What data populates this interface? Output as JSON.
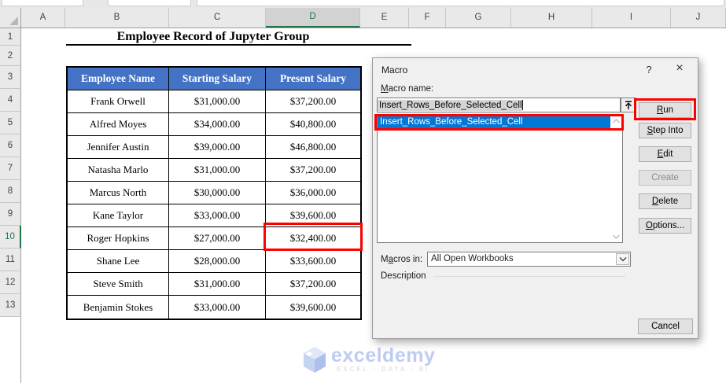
{
  "sheet": {
    "column_labels": [
      "A",
      "B",
      "C",
      "D",
      "E",
      "F",
      "G",
      "H",
      "I",
      "J"
    ],
    "row_labels": [
      "1",
      "2",
      "3",
      "4",
      "5",
      "6",
      "7",
      "8",
      "9",
      "10",
      "11",
      "12",
      "13"
    ],
    "selected_column": "D",
    "selected_row": "10",
    "title": "Employee Record of Jupyter Group",
    "table": {
      "headers": [
        "Employee Name",
        "Starting Salary",
        "Present Salary"
      ],
      "rows": [
        [
          "Frank Orwell",
          "$31,000.00",
          "$37,200.00"
        ],
        [
          "Alfred Moyes",
          "$34,000.00",
          "$40,800.00"
        ],
        [
          "Jennifer Austin",
          "$39,000.00",
          "$46,800.00"
        ],
        [
          "Natasha Marlo",
          "$31,000.00",
          "$37,200.00"
        ],
        [
          "Marcus North",
          "$30,000.00",
          "$36,000.00"
        ],
        [
          "Kane Taylor",
          "$33,000.00",
          "$39,600.00"
        ],
        [
          "Roger Hopkins",
          "$27,000.00",
          "$32,400.00"
        ],
        [
          "Shane Lee",
          "$28,000.00",
          "$33,600.00"
        ],
        [
          "Steve Smith",
          "$31,000.00",
          "$37,200.00"
        ],
        [
          "Benjamin Stokes",
          "$33,000.00",
          "$39,600.00"
        ]
      ],
      "highlighted_cell_value": "$32,400.00"
    }
  },
  "dialog": {
    "title": "Macro",
    "help_label": "?",
    "close_label": "×",
    "macro_name_label": {
      "label": "Macro name:",
      "accel": 0
    },
    "macro_name_value": "Insert_Rows_Before_Selected_Cell",
    "macro_list": [
      "Insert_Rows_Before_Selected_Cell"
    ],
    "action_buttons": [
      {
        "label": "Run",
        "accel": 0,
        "enabled": true
      },
      {
        "label": "Step Into",
        "accel": 0,
        "enabled": true
      },
      {
        "label": "Edit",
        "accel": 0,
        "enabled": true
      },
      {
        "label": "Create",
        "accel": -1,
        "enabled": false
      },
      {
        "label": "Delete",
        "accel": 0,
        "enabled": true
      },
      {
        "label": "Options...",
        "accel": 0,
        "enabled": true
      }
    ],
    "macros_in_label": {
      "label": "Macros in:",
      "accel": 1
    },
    "macros_in_value": "All Open Workbooks",
    "description_label": "Description",
    "cancel_label": "Cancel"
  },
  "watermark": {
    "brand": "exceldemy",
    "tagline": "EXCEL - DATA - BI"
  },
  "colors": {
    "table_header_blue": "#4472C4",
    "list_selection_blue": "#0078D7",
    "excel_green": "#217346",
    "annotation_red": "#FF0000",
    "watermark_blue": "#BDCCF0"
  }
}
